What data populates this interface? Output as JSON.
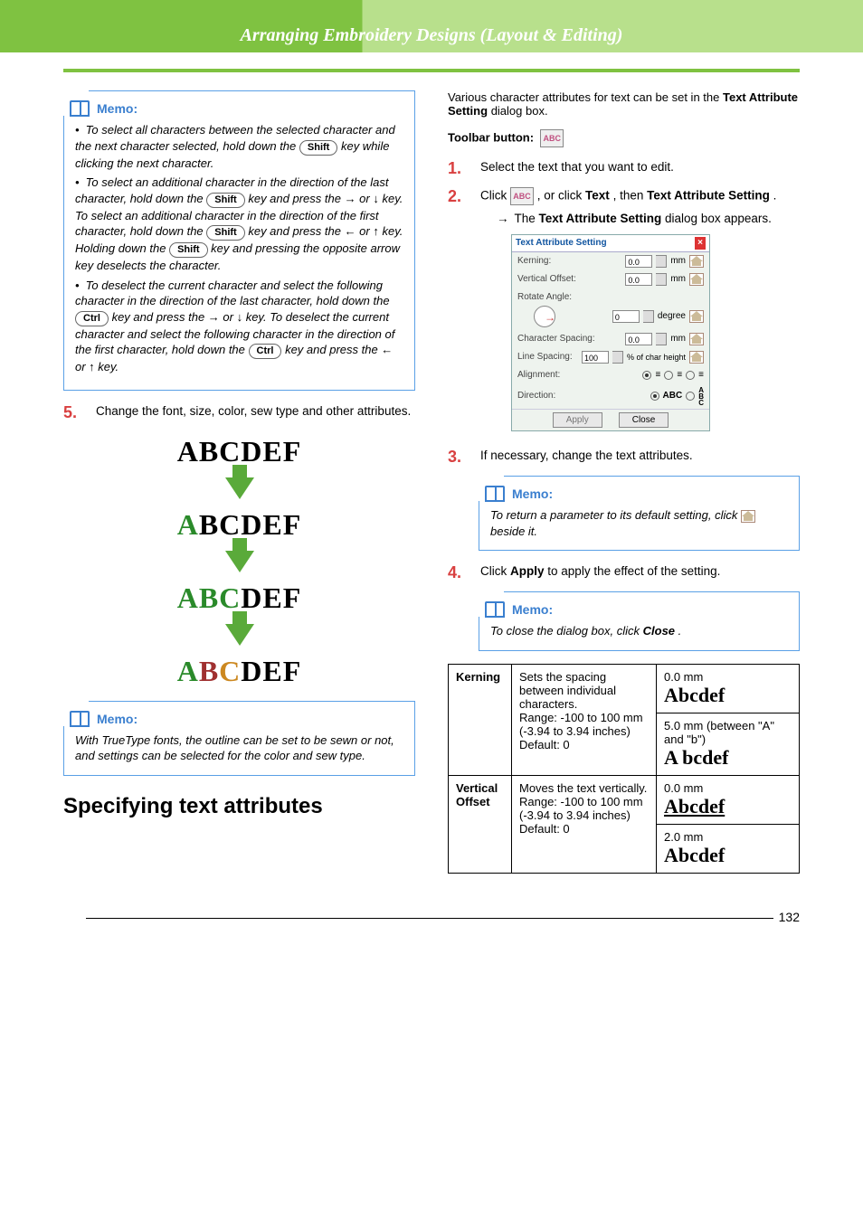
{
  "chapter_title": "Arranging Embroidery Designs (Layout & Editing)",
  "page_number": "132",
  "memo_label": "Memo:",
  "keys": {
    "shift": "Shift",
    "ctrl": "Ctrl"
  },
  "left": {
    "memo1": {
      "b1a": "To select all characters between the selected character and the next character selected, hold down the ",
      "b1b": " key while clicking the next character.",
      "b2a": "To select an additional character in the direction of the last character, hold down the ",
      "b2b": " key and press the → or ↓ key. To select an additional character in the direction of the first character, hold down the ",
      "b2c": " key and press the ← or ↑ key. Holding down the ",
      "b2d": " key and pressing the opposite arrow key deselects the character.",
      "b3a": "To deselect the current character and select the following character in the direction of the last character, hold down the ",
      "b3b": " key and press the → or ↓ key. To deselect the current character and select the following character in the direction of the first character, hold down the ",
      "b3c": " key and press the ← or ↑ key."
    },
    "step5": "Change the font, size, color, sew type and other attributes.",
    "illus_text": "ABCDEF",
    "memo2": "With TrueType fonts, the outline can be set to be sewn or not, and settings can be selected for the color and sew type.",
    "section_heading": "Specifying text attributes"
  },
  "right": {
    "intro_a": "Various character attributes for text can be set in the ",
    "intro_bold": "Text Attribute Setting",
    "intro_b": " dialog box.",
    "toolbar_label": "Toolbar button:",
    "step1": "Select the text that you want to edit.",
    "step2_a": "Click ",
    "step2_b": " , or click ",
    "step2_bold1": "Text",
    "step2_c": ", then ",
    "step2_bold2": "Text Attribute Setting",
    "step2_d": ".",
    "step2_sub_a": "The ",
    "step2_sub_bold": "Text Attribute Setting",
    "step2_sub_b": " dialog box appears.",
    "dialog": {
      "title": "Text Attribute Setting",
      "kerning": "Kerning:",
      "voffset": "Vertical Offset:",
      "rotate": "Rotate Angle:",
      "charsp": "Character Spacing:",
      "linesp": "Line Spacing:",
      "align": "Alignment:",
      "dir": "Direction:",
      "mm": "mm",
      "deg": "degree",
      "pct": "% of char height",
      "v_kern": "0.0",
      "v_voff": "0.0",
      "v_rot": "0",
      "v_chsp": "0.0",
      "v_lnsp": "100",
      "abc": "ABC",
      "apply": "Apply",
      "close": "Close"
    },
    "step3": "If necessary, change the text attributes.",
    "memo3_a": "To return a parameter to its default setting, click ",
    "memo3_b": " beside it.",
    "step4_a": "Click ",
    "step4_bold": "Apply",
    "step4_b": " to apply the effect of the setting.",
    "memo4_a": "To close the dialog box, click ",
    "memo4_bold": "Close",
    "memo4_b": ".",
    "table": {
      "kerning_label": "Kerning",
      "kerning_desc": "Sets the spacing between individual characters.\nRange: -100 to 100 mm (-3.94 to 3.94 inches)\nDefault: 0",
      "kerning_ex1a": "0.0 mm",
      "kerning_ex1b": "Abcdef",
      "kerning_ex2a": "5.0 mm (between \"A\" and \"b\")",
      "kerning_ex2b": "A bcdef",
      "voff_label": "Vertical Offset",
      "voff_desc": "Moves the text vertically.\nRange: -100 to 100 mm (-3.94 to 3.94 inches)\nDefault: 0",
      "voff_ex1a": "0.0 mm",
      "voff_ex1b": "Abcdef",
      "voff_ex2a": "2.0 mm",
      "voff_ex2b": "Abcdef"
    }
  }
}
